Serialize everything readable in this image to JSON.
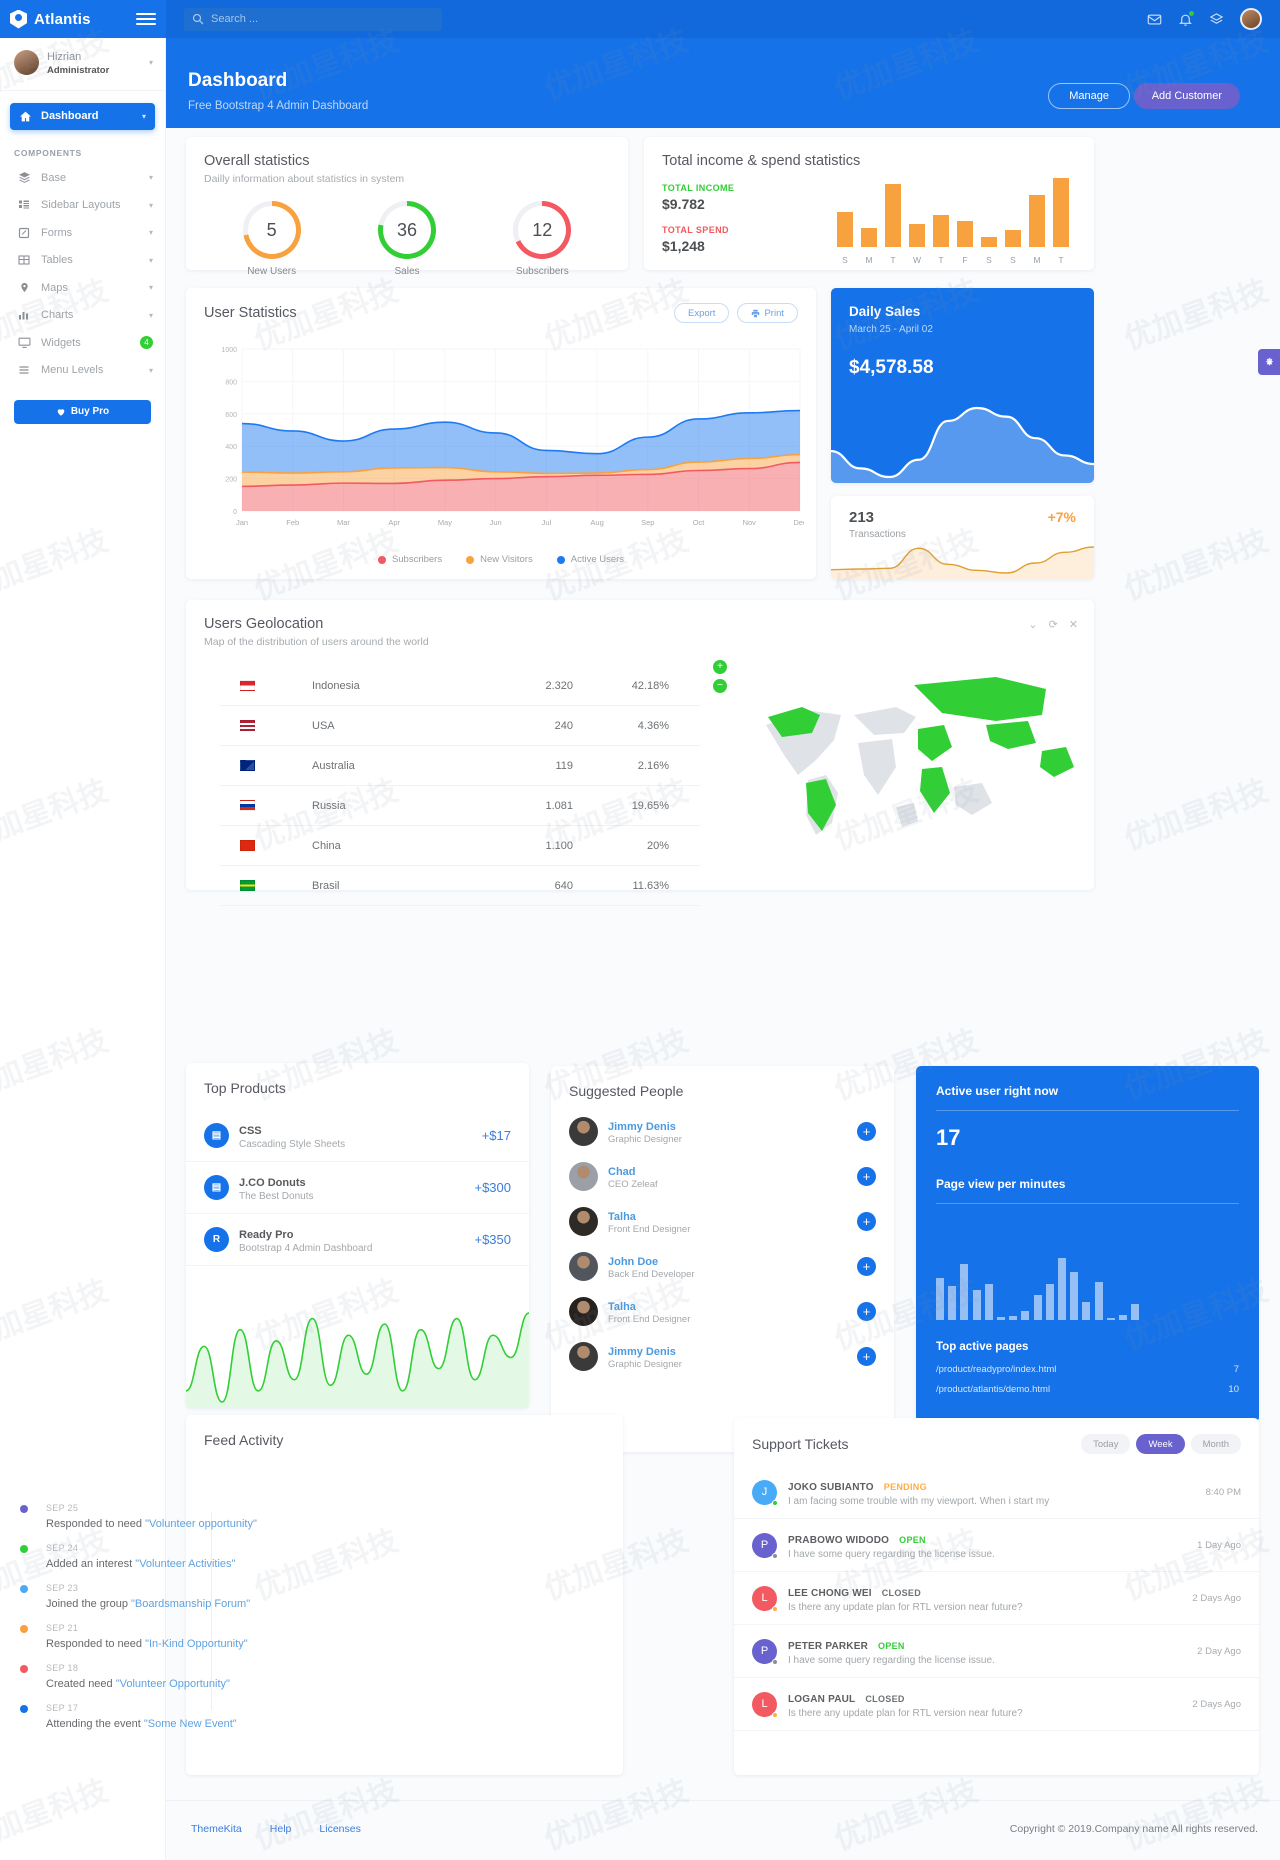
{
  "app": {
    "brand": "Atlantis",
    "logo_icon": "shield-user-icon",
    "menu_toggle_icon": "hamburger-icon"
  },
  "search": {
    "placeholder": "Search ...",
    "icon": "search-icon",
    "value": ""
  },
  "topnav": {
    "mail_icon": "envelope-icon",
    "bell_icon": "bell-icon",
    "layers_icon": "layers-icon",
    "avatar": "user-avatar"
  },
  "sidebar": {
    "profile": {
      "name": "Hizrian",
      "role": "Administrator",
      "caret": "▾"
    },
    "active_item": {
      "label": "Dashboard",
      "icon": "home-icon",
      "caret": "▾"
    },
    "section_title": "COMPONENTS",
    "items": [
      {
        "label": "Base",
        "icon": "layers-icon",
        "caret": "▾"
      },
      {
        "label": "Sidebar Layouts",
        "icon": "list-icon",
        "caret": "▾"
      },
      {
        "label": "Forms",
        "icon": "pencil-square-icon",
        "caret": "▾"
      },
      {
        "label": "Tables",
        "icon": "table-icon",
        "caret": "▾"
      },
      {
        "label": "Maps",
        "icon": "map-pin-icon",
        "caret": "▾"
      },
      {
        "label": "Charts",
        "icon": "bar-chart-icon",
        "caret": "▾"
      },
      {
        "label": "Widgets",
        "icon": "monitor-icon",
        "badge": "4"
      },
      {
        "label": "Menu Levels",
        "icon": "menu-icon",
        "caret": "▾"
      }
    ],
    "buy_pro": {
      "label": "Buy Pro",
      "icon": "heart-icon"
    }
  },
  "header": {
    "title": "Dashboard",
    "subtitle": "Free Bootstrap 4 Admin Dashboard",
    "manage_label": "Manage",
    "add_customer_label": "Add Customer"
  },
  "overall": {
    "title": "Overall statistics",
    "subtitle": "Dailly information about statistics in system",
    "gauges": [
      {
        "value": "5",
        "label": "New Users",
        "color": "#f8a13f",
        "pct": 72
      },
      {
        "value": "36",
        "label": "Sales",
        "color": "#31ce36",
        "pct": 78
      },
      {
        "value": "12",
        "label": "Subscribers",
        "color": "#f25961",
        "pct": 68
      }
    ]
  },
  "income": {
    "title": "Total income & spend statistics",
    "income_label": "TOTAL INCOME",
    "income_value": "$9.782",
    "spend_label": "TOTAL SPEND",
    "spend_value": "$1,248",
    "chart_data": {
      "type": "bar",
      "title": "Total income & spend statistics",
      "categories": [
        "S",
        "M",
        "T",
        "W",
        "T",
        "F",
        "S",
        "S",
        "M",
        "T"
      ],
      "values": [
        48,
        26,
        88,
        32,
        44,
        36,
        14,
        24,
        72,
        96
      ],
      "ylim": [
        0,
        100
      ],
      "series_color": "#f8a13f",
      "xlabel": "",
      "ylabel": "",
      "grid": false
    }
  },
  "user_statistics": {
    "title": "User Statistics",
    "export_label": "Export",
    "print_label": "Print",
    "export_icon": "download-icon",
    "print_icon": "printer-icon",
    "chart_data": {
      "type": "area",
      "title": "User Statistics",
      "x": [
        "Jan",
        "Feb",
        "Mar",
        "Apr",
        "May",
        "Jun",
        "Jul",
        "Aug",
        "Sep",
        "Oct",
        "Nov",
        "Dec"
      ],
      "yticks": [
        0,
        200,
        400,
        600,
        800,
        1000
      ],
      "ylim": [
        0,
        1000
      ],
      "stacked": true,
      "grid": true,
      "legend_position": "bottom",
      "series": [
        {
          "name": "Subscribers",
          "color": "#f25961",
          "values": [
            152,
            160,
            172,
            170,
            190,
            200,
            212,
            220,
            226,
            250,
            262,
            300
          ]
        },
        {
          "name": "New Visitors",
          "color": "#f8a13f",
          "values": [
            88,
            74,
            70,
            96,
            78,
            42,
            20,
            14,
            30,
            52,
            62,
            48
          ]
        },
        {
          "name": "Active Users",
          "color": "#1d7af3",
          "values": [
            300,
            260,
            190,
            240,
            280,
            240,
            142,
            120,
            200,
            266,
            282,
            272
          ]
        }
      ]
    }
  },
  "daily_sales": {
    "title": "Daily Sales",
    "range": "March 25 - April 02",
    "amount": "$4,578.58",
    "chart_data": {
      "type": "area",
      "title": "Daily Sales",
      "values": [
        38,
        30,
        26,
        34,
        52,
        58,
        54,
        44,
        36,
        32
      ],
      "color": "#ffffff"
    }
  },
  "transactions": {
    "value": "213",
    "label": "Transactions",
    "percent": "+7%",
    "chart_data": {
      "type": "area",
      "title": "Transactions",
      "values": [
        14,
        15,
        16,
        46,
        22,
        13,
        9,
        24,
        40,
        48
      ],
      "color": "#f8a13f"
    }
  },
  "geolocation": {
    "title": "Users Geolocation",
    "subtitle": "Map of the distribution of users around the world",
    "tools": {
      "collapse_icon": "chevron-down-icon",
      "refresh_icon": "refresh-icon",
      "close_icon": "close-icon"
    },
    "zoom_in_label": "+",
    "zoom_out_label": "−",
    "rows": [
      {
        "flag": "indonesia",
        "country": "Indonesia",
        "count": "2.320",
        "percent": "42.18%"
      },
      {
        "flag": "usa",
        "country": "USA",
        "count": "240",
        "percent": "4.36%"
      },
      {
        "flag": "australia",
        "country": "Australia",
        "count": "119",
        "percent": "2.16%"
      },
      {
        "flag": "russia",
        "country": "Russia",
        "count": "1.081",
        "percent": "19.65%"
      },
      {
        "flag": "china",
        "country": "China",
        "count": "1.100",
        "percent": "20%"
      },
      {
        "flag": "brasil",
        "country": "Brasil",
        "count": "640",
        "percent": "11.63%"
      }
    ]
  },
  "top_products": {
    "title": "Top Products",
    "rows": [
      {
        "icon": "css3-icon",
        "name": "CSS",
        "desc": "Cascading Style Sheets",
        "amount": "+$17"
      },
      {
        "icon": "css3-icon",
        "name": "J.CO Donuts",
        "desc": "The Best Donuts",
        "amount": "+$300"
      },
      {
        "icon": "readypro-icon",
        "name": "Ready Pro",
        "desc": "Bootstrap 4 Admin Dashboard",
        "amount": "+$350"
      }
    ],
    "chart_data": {
      "type": "line",
      "color": "#31ce36",
      "values": [
        18,
        34,
        14,
        40,
        18,
        36,
        22,
        44,
        20,
        38,
        24,
        42,
        18,
        40,
        26,
        44,
        22,
        38,
        30,
        46
      ]
    }
  },
  "suggested_people": {
    "title": "Suggested People",
    "add_icon": "plus-icon",
    "rows": [
      {
        "name": "Jimmy Denis",
        "role": "Graphic Designer",
        "avatar_color": "#3a3a3a"
      },
      {
        "name": "Chad",
        "role": "CEO Zeleaf",
        "avatar_color": "#9aa0a6"
      },
      {
        "name": "Talha",
        "role": "Front End Designer",
        "avatar_color": "#2e2a26"
      },
      {
        "name": "John Doe",
        "role": "Back End Developer",
        "avatar_color": "#50565c"
      },
      {
        "name": "Talha",
        "role": "Front End Designer",
        "avatar_color": "#26221f"
      },
      {
        "name": "Jimmy Denis",
        "role": "Graphic Designer",
        "avatar_color": "#3a3a3a"
      }
    ]
  },
  "active_users": {
    "title": "Active user right now",
    "count": "17",
    "subtitle": "Page view per minutes",
    "top_pages_title": "Top active pages",
    "pages": [
      {
        "url": "/product/readypro/index.html",
        "views": "7"
      },
      {
        "url": "/product/atlantis/demo.html",
        "views": "10"
      }
    ],
    "chart_data": {
      "type": "bar",
      "title": "Page view per minutes",
      "values": [
        42,
        34,
        56,
        30,
        36,
        3,
        4,
        9,
        25,
        36,
        62,
        48,
        18,
        38,
        2,
        5,
        16
      ],
      "color": "#ffffff"
    }
  },
  "feed_activity": {
    "title": "Feed Activity",
    "items": [
      {
        "date": "SEP 25",
        "prefix": "Responded to need ",
        "link": "\"Volunteer opportunity\"",
        "color": "#6861ce"
      },
      {
        "date": "SEP 24",
        "prefix": "Added an interest ",
        "link": "\"Volunteer Activities\"",
        "color": "#31ce36"
      },
      {
        "date": "SEP 23",
        "prefix": "Joined the group ",
        "link": "\"Boardsmanship Forum\"",
        "color": "#48abf7"
      },
      {
        "date": "SEP 21",
        "prefix": "Responded to need ",
        "link": "\"In-Kind Opportunity\"",
        "color": "#f8a13f"
      },
      {
        "date": "SEP 18",
        "prefix": "Created need ",
        "link": "\"Volunteer Opportunity\"",
        "color": "#f25961"
      },
      {
        "date": "SEP 17",
        "prefix": "Attending the event ",
        "link": "\"Some New Event\"",
        "color": "#1572e8"
      }
    ]
  },
  "support_tickets": {
    "title": "Support Tickets",
    "tabs": [
      {
        "label": "Today",
        "active": false
      },
      {
        "label": "Week",
        "active": true
      },
      {
        "label": "Month",
        "active": false
      }
    ],
    "rows": [
      {
        "initial": "J",
        "av_color": "#48abf7",
        "dot_color": "#31ce36",
        "name": "JOKO SUBIANTO",
        "status": "PENDING",
        "status_color": "#ffad46",
        "message": "I am facing some trouble with my viewport. When i start my",
        "time": "8:40 PM"
      },
      {
        "initial": "P",
        "av_color": "#6861ce",
        "dot_color": "#8a8d92",
        "name": "PRABOWO WIDODO",
        "status": "OPEN",
        "status_color": "#31ce36",
        "message": "I have some query regarding the license issue.",
        "time": "1 Day Ago"
      },
      {
        "initial": "L",
        "av_color": "#f25961",
        "dot_color": "#ffad46",
        "name": "LEE CHONG WEI",
        "status": "CLOSED",
        "status_color": "#6c7175",
        "message": "Is there any update plan for RTL version near future?",
        "time": "2 Days Ago"
      },
      {
        "initial": "P",
        "av_color": "#6861ce",
        "dot_color": "#8a8d92",
        "name": "PETER PARKER",
        "status": "OPEN",
        "status_color": "#31ce36",
        "message": "I have some query regarding the license issue.",
        "time": "2 Day Ago"
      },
      {
        "initial": "L",
        "av_color": "#f25961",
        "dot_color": "#ffad46",
        "name": "LOGAN PAUL",
        "status": "CLOSED",
        "status_color": "#6c7175",
        "message": "Is there any update plan for RTL version near future?",
        "time": "2 Days Ago"
      }
    ]
  },
  "footer": {
    "links": [
      "ThemeKita",
      "Help",
      "Licenses"
    ],
    "copyright": "Copyright © 2019.Company name All rights reserved."
  },
  "fab": {
    "icon": "gear-icon"
  },
  "watermark": "优加星科技"
}
